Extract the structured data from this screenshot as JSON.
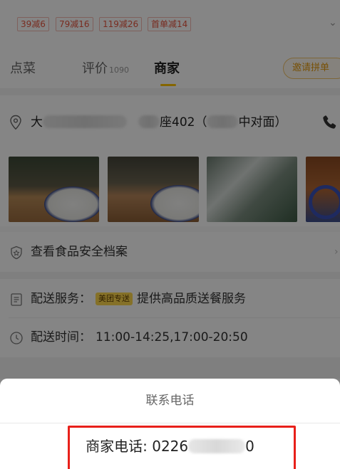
{
  "promos": [
    "39减6",
    "79减16",
    "119减26",
    "首单减14"
  ],
  "tabs": {
    "order": "点菜",
    "reviews": "评价",
    "reviews_count": "1090",
    "merchant": "商家",
    "invite_button": "邀请拼单"
  },
  "address": {
    "prefix": "大",
    "middle": "座402（",
    "suffix": "中对面）"
  },
  "rows": {
    "food_safety": "查看食品安全档案",
    "delivery_service_label": "配送服务：",
    "delivery_badge": "美团专送",
    "delivery_service_text": "提供高品质送餐服务",
    "delivery_time_label": "配送时间：",
    "delivery_time_value": "11:00-14:25,17:00-20:50"
  },
  "sheet": {
    "title": "联系电话",
    "phone_label": "商家电话: ",
    "phone_start": "0226",
    "phone_end": "0"
  },
  "colors": {
    "accent": "#ffc300",
    "promo_red": "#e7553f",
    "highlight_red": "#e8201a"
  }
}
